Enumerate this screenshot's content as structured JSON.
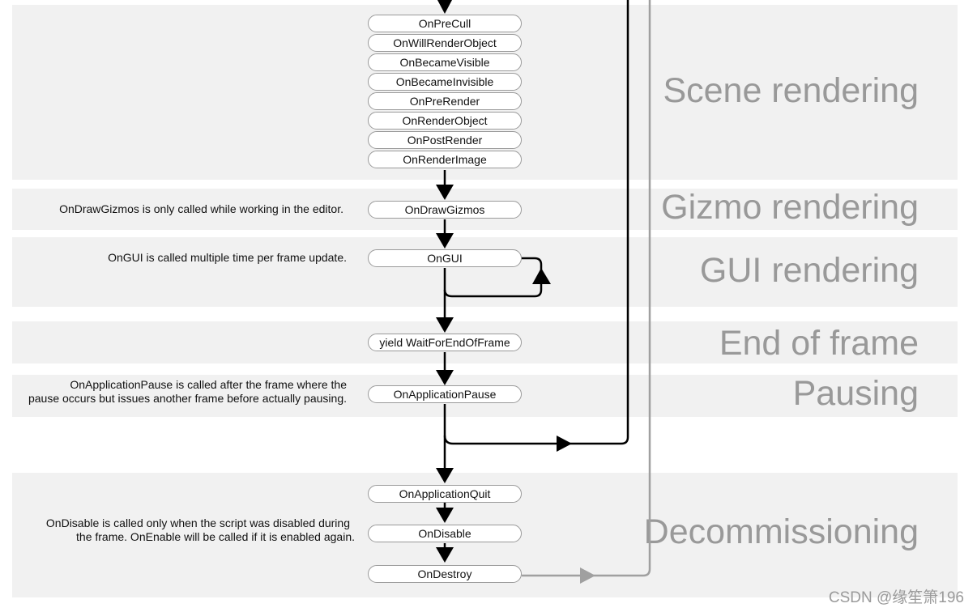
{
  "sections": [
    {
      "id": "scene",
      "title": "Scene rendering"
    },
    {
      "id": "gizmo",
      "title": "Gizmo rendering"
    },
    {
      "id": "gui",
      "title": "GUI rendering"
    },
    {
      "id": "endframe",
      "title": "End of frame"
    },
    {
      "id": "pausing",
      "title": "Pausing"
    },
    {
      "id": "decom",
      "title": "Decommissioning"
    }
  ],
  "nodes": {
    "scene": [
      "OnPreCull",
      "OnWillRenderObject",
      "OnBecameVisible",
      "OnBecameInvisible",
      "OnPreRender",
      "OnRenderObject",
      "OnPostRender",
      "OnRenderImage"
    ],
    "gizmo": "OnDrawGizmos",
    "gui": "OnGUI",
    "endframe": "yield WaitForEndOfFrame",
    "pausing": "OnApplicationPause",
    "decom": [
      "OnApplicationQuit",
      "OnDisable",
      "OnDestroy"
    ]
  },
  "notes": {
    "gizmo": "OnDrawGizmos is only called while working in the editor.",
    "gui": "OnGUI is called multiple time per frame update.",
    "pausing": [
      "OnApplicationPause is called after the frame where the",
      "pause occurs but issues another frame before actually pausing."
    ],
    "decom": [
      "OnDisable is called only when the script was disabled during",
      "the frame. OnEnable will be called if it is enabled again."
    ]
  },
  "colors": {
    "panel": "#f1f1f1",
    "section_title": "#999999",
    "flow_line": "#000000",
    "exit_line": "#a0a0a0"
  },
  "watermark": "CSDN @缘笙箫196"
}
